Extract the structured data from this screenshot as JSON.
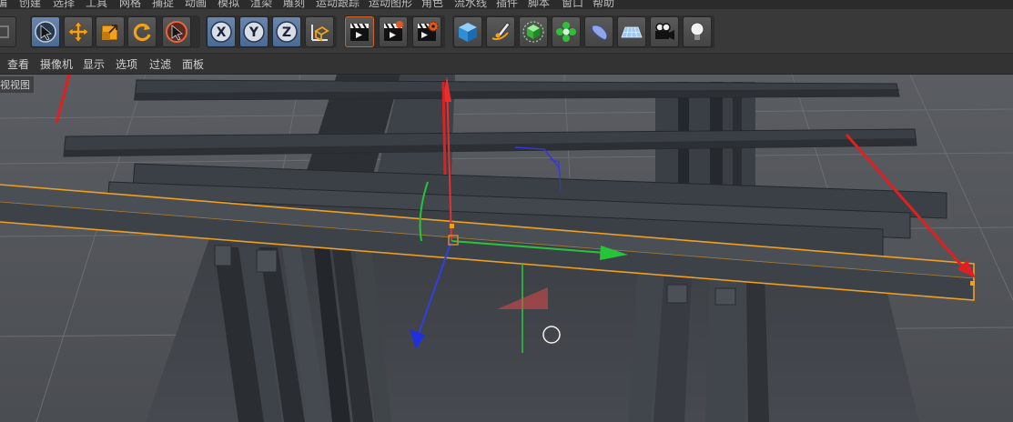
{
  "menubar": {
    "items": [
      "编",
      "创建",
      "选择",
      "工具",
      "网格",
      "捕捉",
      "动画",
      "模拟",
      "渲染",
      "雕刻",
      "运动跟踪",
      "运动图形",
      "角色",
      "流水线",
      "插件",
      "脚本",
      "窗口",
      "帮助"
    ]
  },
  "toolbar": {
    "tools": [
      {
        "name": "live-selection",
        "icon": "cursor-circle-icon"
      },
      {
        "name": "move",
        "icon": "move-cross-icon"
      },
      {
        "name": "scale",
        "icon": "scale-box-icon"
      },
      {
        "name": "rotate",
        "icon": "rotate-arrows-icon"
      },
      {
        "name": "last-tool",
        "icon": "cursor-circle-red-icon"
      },
      {
        "name": "x-axis-lock",
        "label": "X"
      },
      {
        "name": "y-axis-lock",
        "label": "Y"
      },
      {
        "name": "z-axis-lock",
        "label": "Z"
      },
      {
        "name": "coordinate-system",
        "icon": "axes-icon"
      },
      {
        "name": "render-view",
        "icon": "clapper-icon"
      },
      {
        "name": "render-to-picture-viewer",
        "icon": "clapper-play-icon"
      },
      {
        "name": "render-settings",
        "icon": "clapper-gear-icon"
      },
      {
        "name": "cube",
        "icon": "cube-icon"
      },
      {
        "name": "pen",
        "icon": "pen-icon"
      },
      {
        "name": "subdivision",
        "icon": "green-cube-icon"
      },
      {
        "name": "array",
        "icon": "flower-icon"
      },
      {
        "name": "deformer",
        "icon": "bend-icon"
      },
      {
        "name": "floor",
        "icon": "grid-plane-icon"
      },
      {
        "name": "camera",
        "icon": "camera-icon"
      },
      {
        "name": "light",
        "icon": "lightbulb-icon"
      }
    ],
    "active_tool": "move"
  },
  "viewport_menu": {
    "items": [
      "查看",
      "摄像机",
      "显示",
      "选项",
      "过滤",
      "面板"
    ]
  },
  "viewport": {
    "label": "视视图"
  }
}
